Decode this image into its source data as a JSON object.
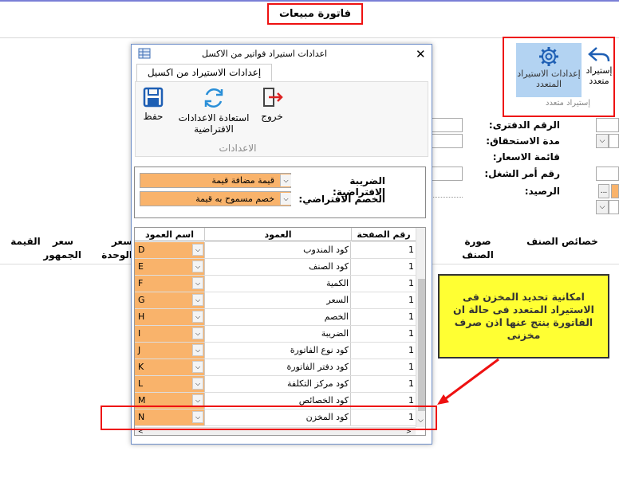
{
  "page": {
    "title": "فاتورة مبيعات"
  },
  "ribbon": {
    "multi_settings_label": "إعدادات الاستيراد المتعدد",
    "multi_import_label": "إستيراد متعدد",
    "group_label": "إستيراد متعدد"
  },
  "form": {
    "ledger_number": "الرقم الدفترى:",
    "due_period": "مدة الاستحقاق:",
    "price_list": "قائمة الاسعار:",
    "work_order": "رقم أمر الشغل:",
    "balance": "الرصيد:",
    "dots_button": "..."
  },
  "grid_header": {
    "item_props": "خصائص الصنف",
    "item_image": "صورة الصنف",
    "unit_price": "سعر الوحدة",
    "public_price": "سعر الجمهور",
    "value": "القيمة"
  },
  "dialog": {
    "title": "اعدادات استيراد فواتير من الاكسل",
    "tab_label": "إعدادات الاستيراد من اكسيل",
    "save_label": "حفظ",
    "restore_label": "استعادة الاعدادات الافتراضية",
    "exit_label": "خروج",
    "group_label": "الاعدادات",
    "default_tax_label": "الضريبة الافتراضية:",
    "default_tax_value": "قيمة مضافة قيمة",
    "default_discount_label": "الخصم الافتراضي:",
    "default_discount_value": "خصم مسموح به قيمة",
    "columns": {
      "page_number": "رقم الصفحة",
      "column": "العمود",
      "column_name": "اسم العمود"
    },
    "rows": [
      {
        "page": "1",
        "column": "كود المندوب",
        "letter": "D"
      },
      {
        "page": "1",
        "column": "كود الصنف",
        "letter": "E"
      },
      {
        "page": "1",
        "column": "الكمية",
        "letter": "F"
      },
      {
        "page": "1",
        "column": "السعر",
        "letter": "G"
      },
      {
        "page": "1",
        "column": "الخصم",
        "letter": "H"
      },
      {
        "page": "1",
        "column": "الضريبة",
        "letter": "I"
      },
      {
        "page": "1",
        "column": "كود نوع الفاتورة",
        "letter": "J"
      },
      {
        "page": "1",
        "column": "كود دفتر الفاتورة",
        "letter": "K"
      },
      {
        "page": "1",
        "column": "كود مركز التكلفة",
        "letter": "L"
      },
      {
        "page": "1",
        "column": "كود الخصائص",
        "letter": "M"
      },
      {
        "page": "1",
        "column": "كود المخزن",
        "letter": "N"
      }
    ]
  },
  "callout": {
    "text": "امكانية تحديد المخزن فى الاستيراد المتعدد فى حالة ان الفاتورة ينتج عنها اذن صرف مخزنى"
  },
  "colors": {
    "accent_orange": "#f9b36b",
    "highlight_red": "#ee1111",
    "callout_yellow": "#ffff33",
    "selected_blue": "#b3d3f2"
  }
}
